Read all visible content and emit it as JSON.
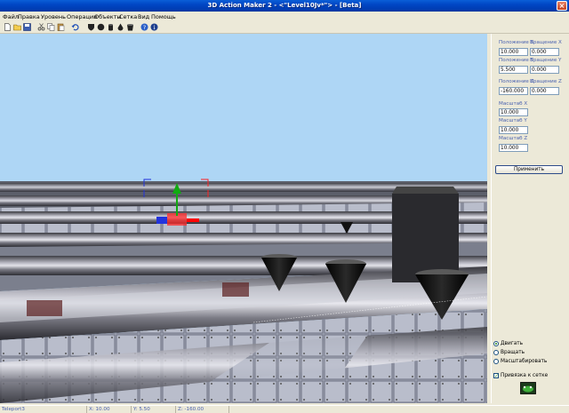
{
  "window": {
    "title": "3D Action Maker 2 - <\"Level10Jv*\"> - [Beta]"
  },
  "menu": [
    "Файл",
    "Правка",
    "Уровень",
    "Операции",
    "Объекты",
    "Сетка",
    "Вид",
    "Помощь"
  ],
  "toolbar": {
    "icons": [
      "new-icon",
      "open-icon",
      "save-icon",
      "cut-icon",
      "copy-icon",
      "paste-icon",
      "undo-icon",
      "shield-icon",
      "sphere-icon",
      "cylinder-icon",
      "drop-icon",
      "bucket-icon",
      "help-icon",
      "info-icon"
    ]
  },
  "panel": {
    "pos_x_label": "Положение X",
    "rot_x_label": "Вращение X",
    "pos_x": "10.000",
    "rot_x": "0.000",
    "pos_y_label": "Положение Y",
    "rot_y_label": "Вращение Y",
    "pos_y": "5.500",
    "rot_y": "0.000",
    "pos_z_label": "Положение Z",
    "rot_z_label": "Вращение Z",
    "pos_z": "-160.000",
    "rot_z": "0.000",
    "scale_x_label": "Масштаб X",
    "scale_x": "10.000",
    "scale_y_label": "Масштаб Y",
    "scale_y": "10.000",
    "scale_z_label": "Масштаб Z",
    "scale_z": "10.000",
    "apply_label": "Применить",
    "mode_move": "Двигать",
    "mode_rotate": "Вращать",
    "mode_scale": "Масштабировать",
    "snap_label": "Привязка к сетке"
  },
  "status": {
    "object": "Teleport3",
    "x": "X: 10.00",
    "y": "Y: 5.50",
    "z": "Z: -160.00"
  },
  "colors": {
    "sky": "#aed6f5",
    "titlebar": "#0046c4",
    "selection": "#ff2a2a"
  }
}
